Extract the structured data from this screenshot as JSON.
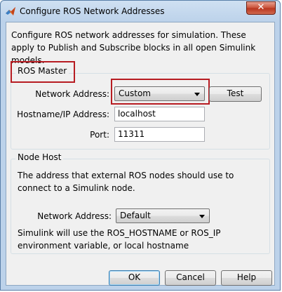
{
  "window": {
    "title": "Configure ROS Network Addresses",
    "close_symbol": "✕",
    "app_icon": "matlab-icon"
  },
  "description": "Configure ROS network addresses for simulation. These apply to Publish and Subscribe blocks in all open Simulink models.",
  "ros_master": {
    "group_title": "ROS Master",
    "network_address_label": "Network Address:",
    "network_address_value": "Custom",
    "test_button": "Test",
    "hostname_label": "Hostname/IP Address:",
    "hostname_value": "localhost",
    "port_label": "Port:",
    "port_value": "11311"
  },
  "node_host": {
    "group_title": "Node Host",
    "info": "The address that external ROS nodes should use to connect to a Simulink node.",
    "network_address_label": "Network Address:",
    "network_address_value": "Default",
    "note": "Simulink will use the ROS_HOSTNAME or ROS_IP environment variable, or local hostname"
  },
  "buttons": {
    "ok": "OK",
    "cancel": "Cancel",
    "help": "Help"
  },
  "colors": {
    "highlight_box": "#b71c22",
    "titlebar": "#bcd2ea",
    "client": "#f0f0f0"
  }
}
